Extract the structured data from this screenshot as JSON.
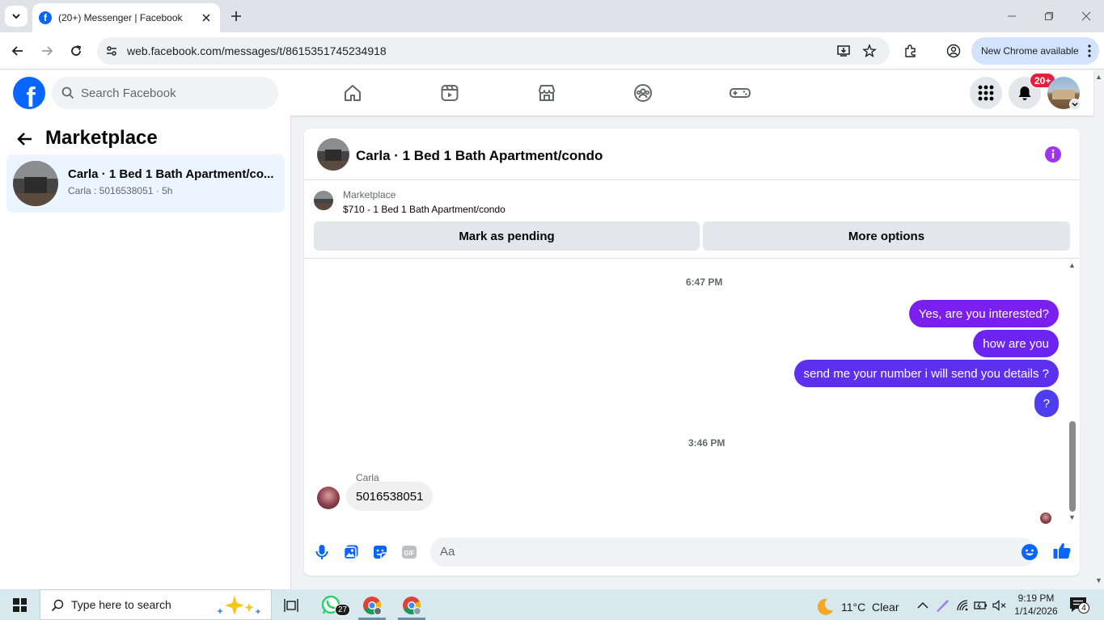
{
  "browser": {
    "tab_title": "(20+) Messenger | Facebook",
    "url": "web.facebook.com/messages/t/8615351745234918",
    "new_chrome_label": "New Chrome available"
  },
  "fb_header": {
    "search_placeholder": "Search Facebook",
    "notification_badge": "20+",
    "nav_icons": [
      "home-icon",
      "watch-icon",
      "marketplace-icon",
      "groups-icon",
      "gaming-icon"
    ]
  },
  "sidebar": {
    "title": "Marketplace",
    "conversations": [
      {
        "name": "Carla · 1 Bed 1 Bath Apartment/co...",
        "preview": "Carla : 5016538051 · 5h"
      }
    ]
  },
  "chat": {
    "title": "Carla · 1 Bed 1 Bath Apartment/condo",
    "listing": {
      "source": "Marketplace",
      "name": "$710 - 1 Bed 1 Bath Apartment/condo"
    },
    "actions": {
      "mark_pending": "Mark as pending",
      "more_options": "More options"
    },
    "timestamps": [
      "6:47 PM",
      "3:46 PM"
    ],
    "outgoing": [
      "Yes, are you interested?",
      "how are you",
      "send me your number i will send you details ?",
      "?"
    ],
    "incoming": {
      "sender": "Carla",
      "text": "5016538051"
    },
    "composer_placeholder": "Aa"
  },
  "colors": {
    "accent_blue": "#0866ff",
    "bubble_purple": "#7a1ff0",
    "bubble_indigo": "#4f3df0",
    "info_purple": "#a033f0"
  },
  "taskbar": {
    "search_placeholder": "Type here to search",
    "whatsapp_badge": "27",
    "weather": "11°C  Clear",
    "time": "9:19 PM",
    "date": "1/14/2026",
    "notification_count": "4"
  }
}
